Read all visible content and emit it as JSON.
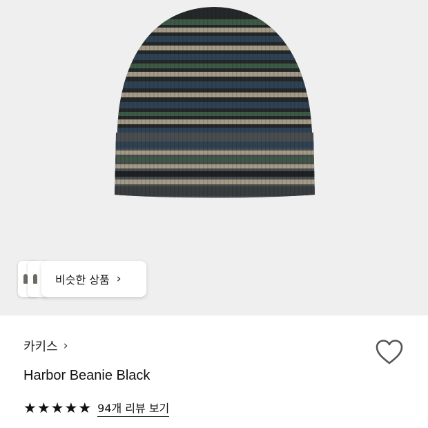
{
  "similar": {
    "label": "비슷한 상품"
  },
  "product": {
    "brand": "카키스",
    "name": "Harbor Beanie Black",
    "rating": 5,
    "reviews_label": "94개 리뷰 보기"
  },
  "colors": {
    "hero_bg": "#efefef",
    "stripe_navy": "#2f4254",
    "stripe_green": "#3d5a46",
    "stripe_beige": "#a39a87",
    "stripe_black": "#1f2224"
  }
}
